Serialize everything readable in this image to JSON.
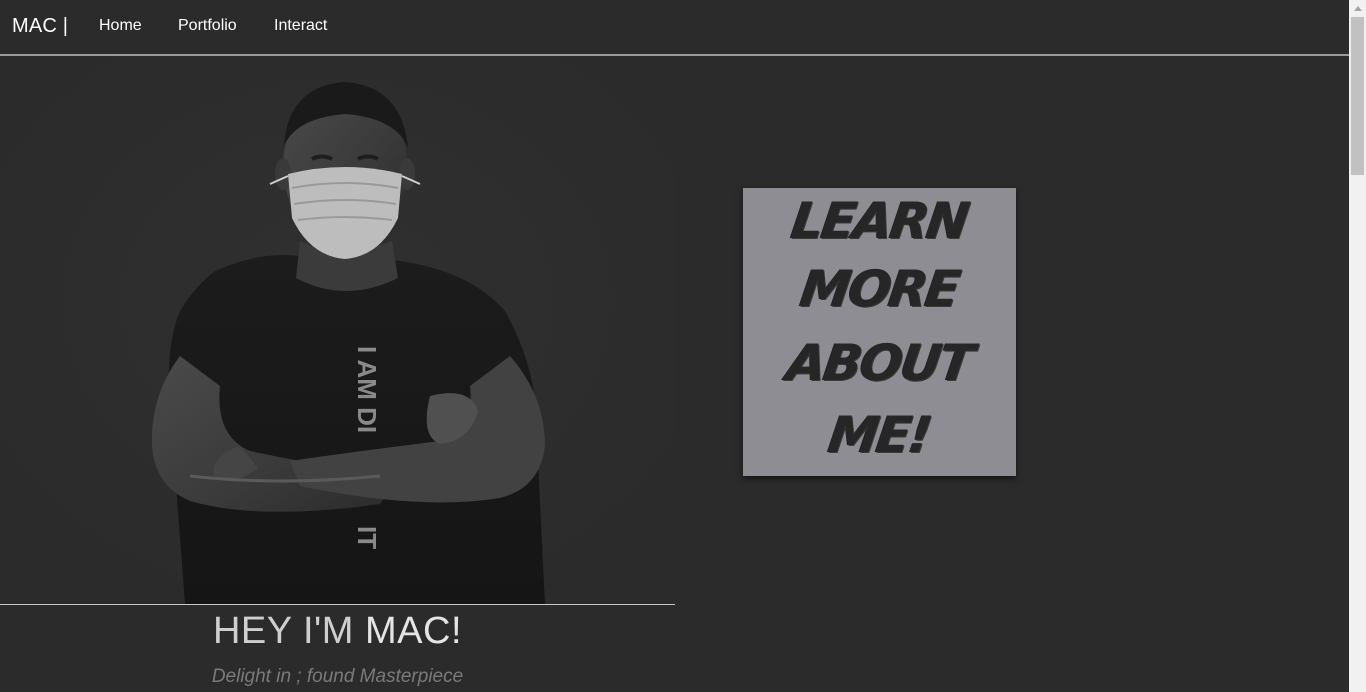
{
  "nav": {
    "brand": "MAC |",
    "links": [
      "Home",
      "Portfolio",
      "Interact"
    ]
  },
  "hero": {
    "shirt_text": "I AM DI",
    "shirt_text_bottom": "IT",
    "title_light": "HEY I'M ",
    "title_strong": "MAC!",
    "tagline": "Delight in ; found Masterpiece"
  },
  "card": {
    "lines": [
      "LEARN",
      "MORE",
      "ABOUT",
      "ME!"
    ]
  },
  "colors": {
    "background": "#2b2b2b",
    "card": "#8e8d94",
    "divider": "#9a9a9a"
  }
}
